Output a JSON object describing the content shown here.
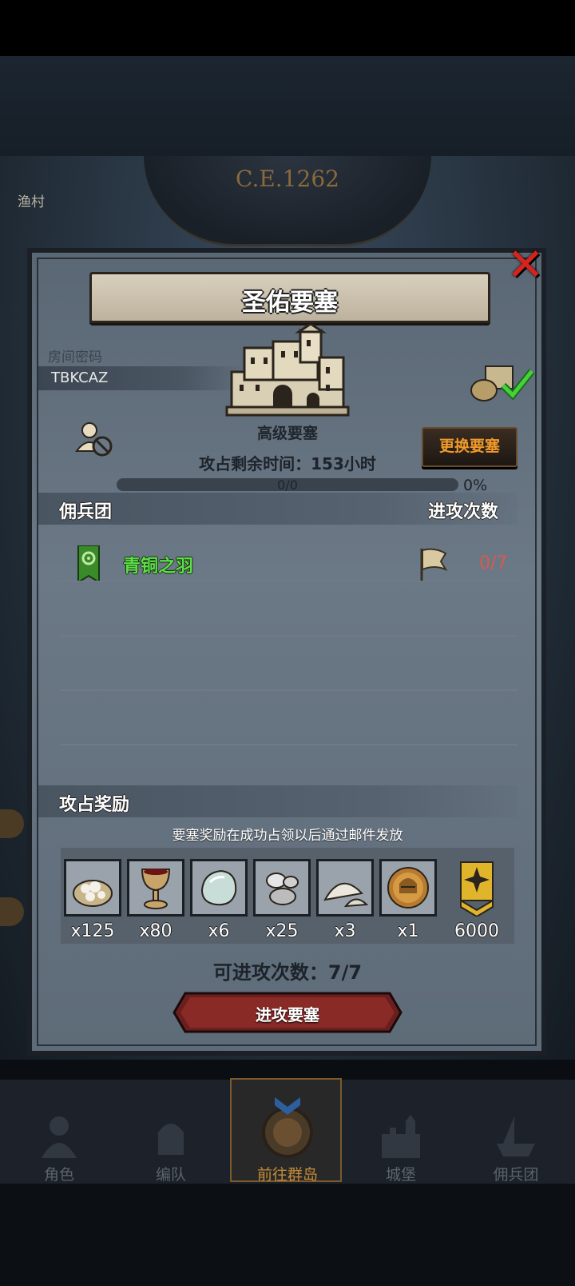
{
  "map": {
    "date": "C.E.1262",
    "label": "渔村"
  },
  "dialog": {
    "title": "圣佑要塞",
    "room_label": "房间密码",
    "room_code": "TBKCAZ",
    "fort_level": "高级要塞",
    "change_button": "更换要塞",
    "time_left": "攻占剩余时间：153小时",
    "progress_text": "0/0",
    "progress_pct": "0%",
    "progress_value": 0,
    "section_guild": "佣兵团",
    "section_attacks": "进攻次数",
    "guilds": [
      {
        "name": "青铜之羽",
        "attacks": "0/7"
      }
    ],
    "reward_section": "攻占奖励",
    "reward_note": "要塞奖励在成功占领以后通过邮件发放",
    "rewards": [
      {
        "icon": "flour-sack-icon",
        "qty": "x125"
      },
      {
        "icon": "goblet-icon",
        "qty": "x80"
      },
      {
        "icon": "gem-stone-icon",
        "qty": "x6"
      },
      {
        "icon": "silver-ore-icon",
        "qty": "x25"
      },
      {
        "icon": "salt-pile-icon",
        "qty": "x3"
      },
      {
        "icon": "knight-helmet-coin-icon",
        "qty": "x1"
      }
    ],
    "medal_qty": "6000",
    "attack_left": "可进攻次数：7/7",
    "attack_button": "进攻要塞"
  },
  "nav": {
    "items": [
      {
        "label": "角色",
        "active": false
      },
      {
        "label": "编队",
        "active": false
      },
      {
        "label": "前往群岛",
        "active": true
      },
      {
        "label": "城堡",
        "active": false
      },
      {
        "label": "佣兵团",
        "active": false
      }
    ]
  },
  "colors": {
    "guild_green": "#5ce049",
    "attack_red": "#d95a4e",
    "button_orange": "#f09a2a",
    "close_red": "#d8221c"
  }
}
